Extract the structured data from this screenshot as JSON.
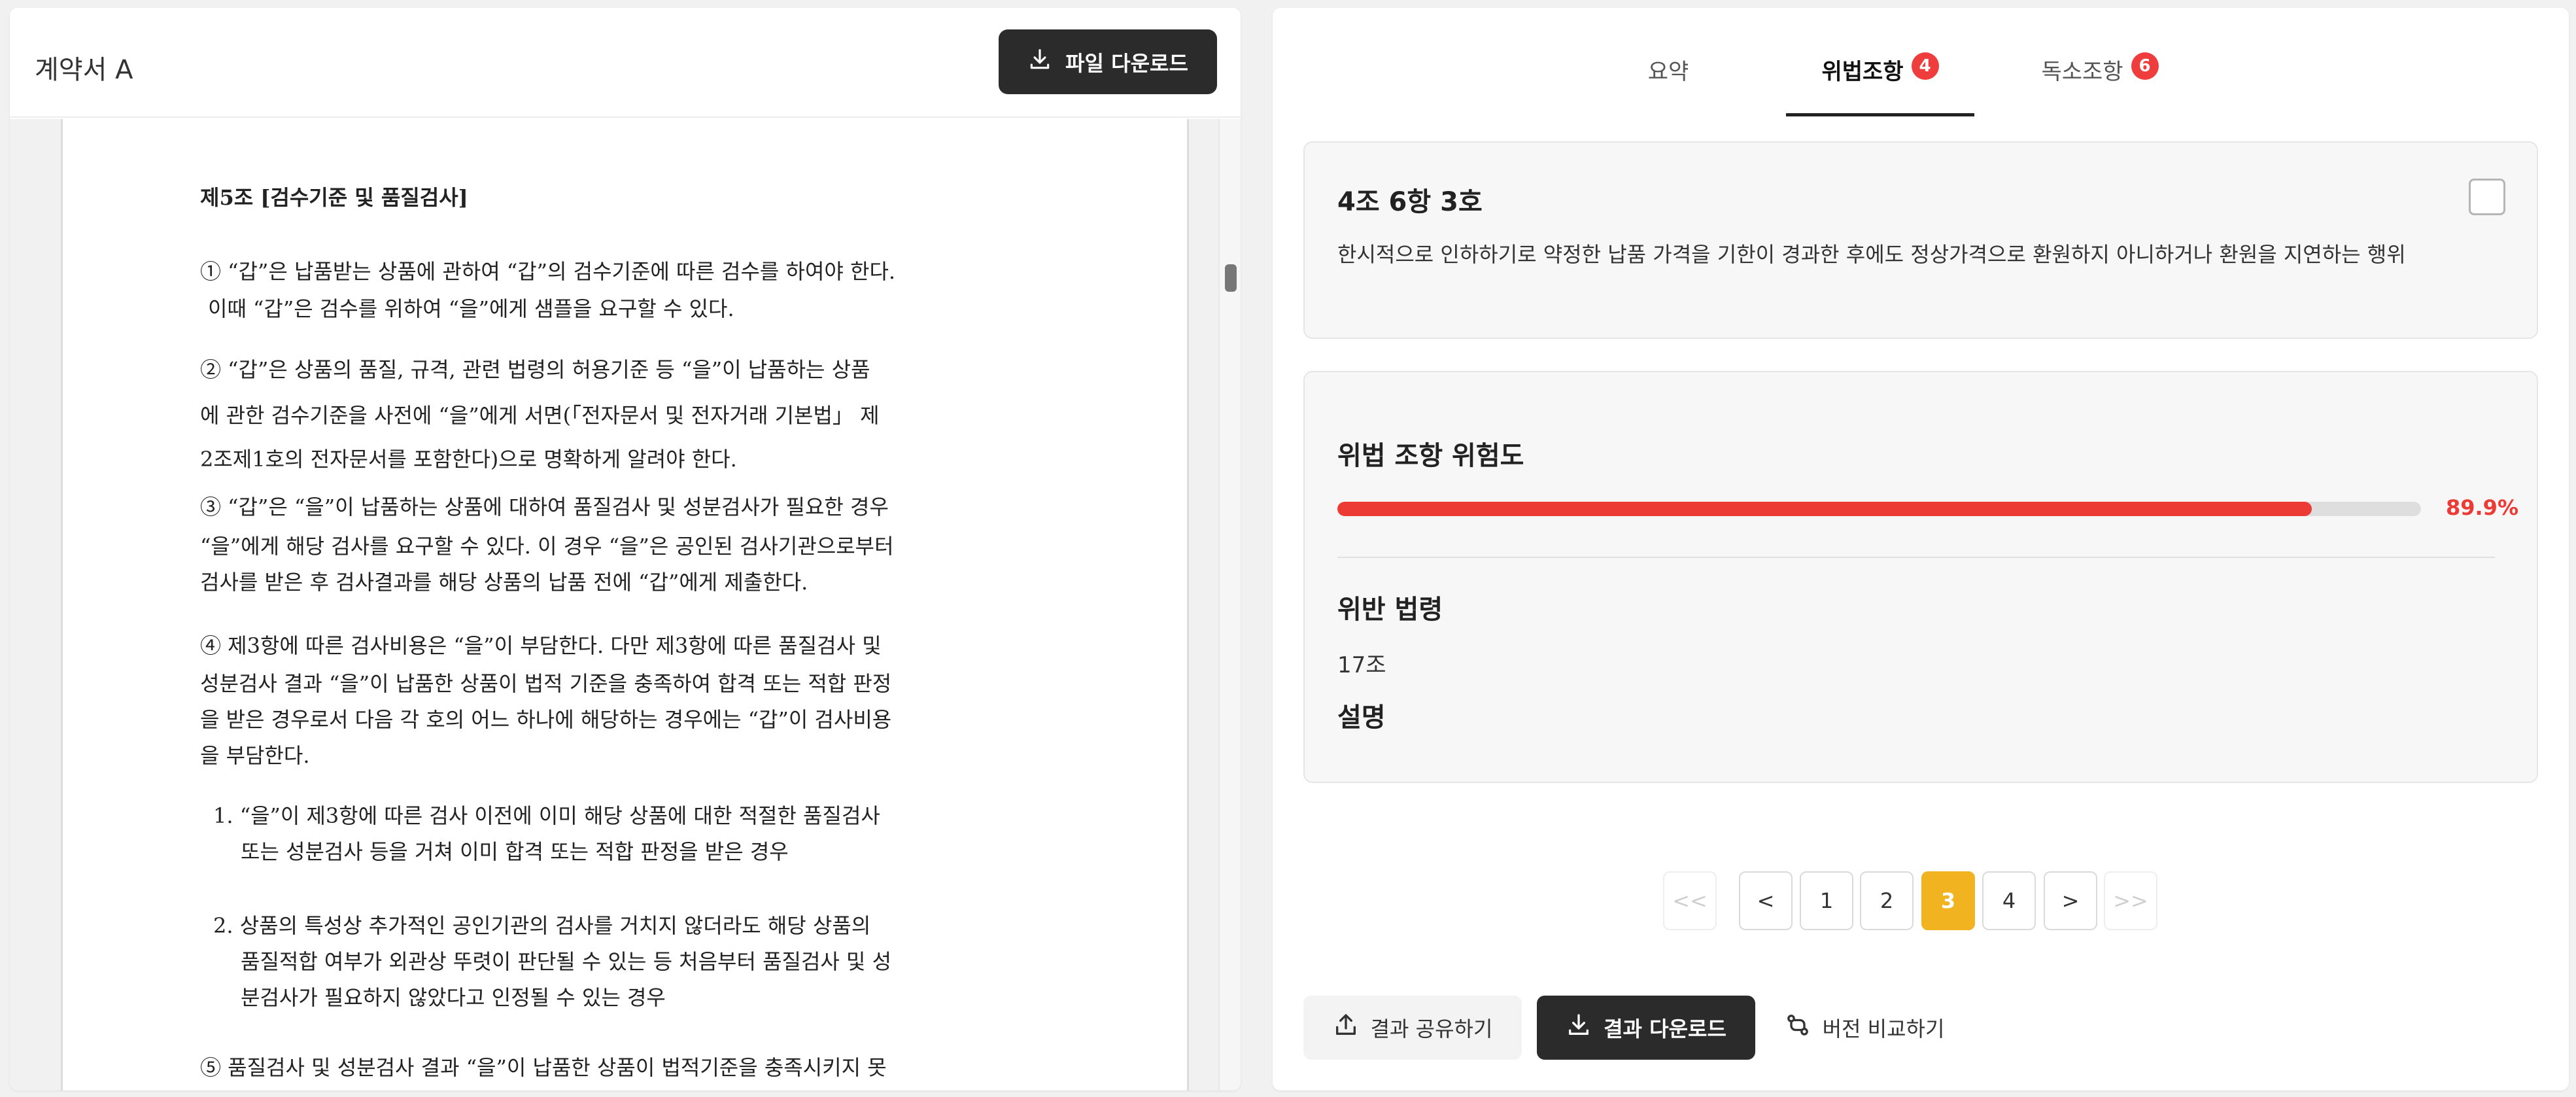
{
  "document": {
    "title": "계약서 A",
    "download_label": "파일 다운로드",
    "lines": [
      "제5조 [검수기준 및 품질검사]",
      "① “갑”은 납품받는 상품에 관하여 “갑”의 검수기준에 따른 검수를 하여야 한다.",
      "이때 “갑”은 검수를 위하여 “을”에게 샘플을 요구할 수 있다.",
      "② “갑”은 상품의 품질, 규격, 관련 법령의 허용기준 등 “을”이 납품하는 상품",
      "에 관한 검수기준을 사전에 “을”에게 서면(「전자문서 및 전자거래 기본법」 제",
      "2조제1호의 전자문서를 포함한다)으로 명확하게 알려야 한다.",
      "③ “갑”은 “을”이 납품하는 상품에 대하여 품질검사 및 성분검사가 필요한 경우",
      "“을”에게 해당 검사를 요구할 수 있다. 이 경우 “을”은 공인된 검사기관으로부터",
      "검사를 받은 후 검사결과를 해당 상품의 납품 전에 “갑”에게 제출한다.",
      "④ 제3항에 따른 검사비용은 “을”이 부담한다. 다만 제3항에 따른 품질검사 및",
      "성분검사 결과 “을”이 납품한 상품이 법적 기준을 충족하여 합격 또는 적합 판정",
      "을 받은 경우로서 다음 각 호의 어느 하나에 해당하는 경우에는 “갑”이 검사비용",
      "을 부담한다.",
      "1. “을”이 제3항에 따른 검사 이전에 이미 해당 상품에 대한 적절한 품질검사",
      "또는 성분검사 등을 거쳐 이미 합격 또는 적합 판정을 받은 경우",
      "2. 상품의 특성상 추가적인 공인기관의 검사를 거치지 않더라도 해당 상품의",
      "품질적합 여부가 외관상 뚜렷이 판단될 수 있는 등 처음부터 품질검사 및 성",
      "분검사가 필요하지 않았다고 인정될 수 있는 경우",
      "⑤ 품질검사 및 성분검사 결과 “을”이 납품한 상품이 법적기준을 충족시키지 못"
    ]
  },
  "tabs": [
    {
      "label": "요약",
      "badge": null,
      "active": false
    },
    {
      "label": "위법조항",
      "badge": "4",
      "active": true
    },
    {
      "label": "독소조항",
      "badge": "6",
      "active": false
    }
  ],
  "clause": {
    "title": "4조 6항 3호",
    "description": "한시적으로 인하하기로 약정한 납품 가격을 기한이 경과한 후에도 정상가격으로 환원하지 아니하거나 환원을 지연하는 행위"
  },
  "risk": {
    "title": "위법 조항 위험도",
    "value": 0.899,
    "label": "89.9%",
    "bar_color": "#ec3b34"
  },
  "law": {
    "title": "위반 법령",
    "value": "17조",
    "desc_title": "설명"
  },
  "pagination": {
    "first": "<<",
    "prev": "<",
    "next": ">",
    "last": ">>",
    "pages": [
      "1",
      "2",
      "3",
      "4"
    ],
    "current": "3",
    "accent": "#f2b320"
  },
  "actions": {
    "share": "결과 공유하기",
    "download": "결과 다운로드",
    "compare": "버전 비교하기"
  }
}
